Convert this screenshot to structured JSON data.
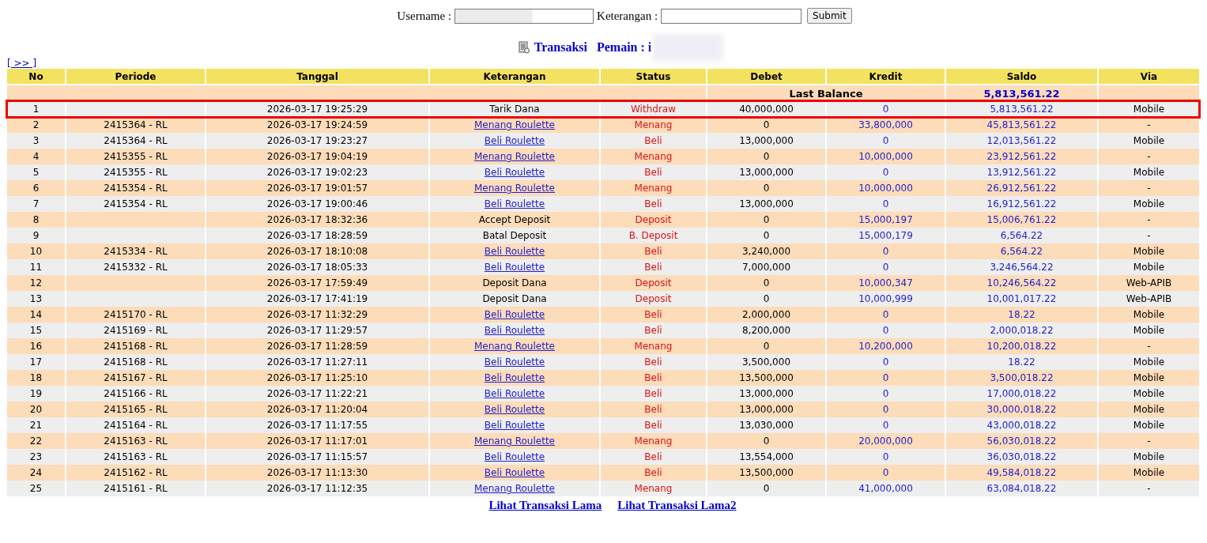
{
  "form": {
    "username_label": "Username :",
    "keterangan_label": "Keterangan :",
    "submit": "Submit"
  },
  "heading": {
    "title": "Transaksi",
    "player": "Pemain : i"
  },
  "next_link": "[ >> ]",
  "table": {
    "columns": [
      "No",
      "Periode",
      "Tanggal",
      "Keterangan",
      "Status",
      "Debet",
      "Kredit",
      "Saldo",
      "Via"
    ],
    "last_balance": {
      "label": "Last Balance",
      "value": "5,813,561.22"
    },
    "rows": [
      {
        "no": "1",
        "periode": "",
        "tanggal": "2026-03-17 19:25:29",
        "keterangan": "Tarik Dana",
        "link": false,
        "status": "Withdraw",
        "debet": "40,000,000",
        "kredit": "0",
        "saldo": "5,813,561.22",
        "via": "Mobile",
        "highlighted": true
      },
      {
        "no": "2",
        "periode": "2415364 - RL",
        "tanggal": "2026-03-17 19:24:59",
        "keterangan": "Menang Roulette",
        "link": true,
        "status": "Menang",
        "debet": "0",
        "kredit": "33,800,000",
        "saldo": "45,813,561.22",
        "via": "-",
        "highlighted": false
      },
      {
        "no": "3",
        "periode": "2415364 - RL",
        "tanggal": "2026-03-17 19:23:27",
        "keterangan": "Beli Roulette",
        "link": true,
        "status": "Beli",
        "debet": "13,000,000",
        "kredit": "0",
        "saldo": "12,013,561.22",
        "via": "Mobile",
        "highlighted": false
      },
      {
        "no": "4",
        "periode": "2415355 - RL",
        "tanggal": "2026-03-17 19:04:19",
        "keterangan": "Menang Roulette",
        "link": true,
        "status": "Menang",
        "debet": "0",
        "kredit": "10,000,000",
        "saldo": "23,912,561.22",
        "via": "-",
        "highlighted": false
      },
      {
        "no": "5",
        "periode": "2415355 - RL",
        "tanggal": "2026-03-17 19:02:23",
        "keterangan": "Beli Roulette",
        "link": true,
        "status": "Beli",
        "debet": "13,000,000",
        "kredit": "0",
        "saldo": "13,912,561.22",
        "via": "Mobile",
        "highlighted": false
      },
      {
        "no": "6",
        "periode": "2415354 - RL",
        "tanggal": "2026-03-17 19:01:57",
        "keterangan": "Menang Roulette",
        "link": true,
        "status": "Menang",
        "debet": "0",
        "kredit": "10,000,000",
        "saldo": "26,912,561.22",
        "via": "-",
        "highlighted": false
      },
      {
        "no": "7",
        "periode": "2415354 - RL",
        "tanggal": "2026-03-17 19:00:46",
        "keterangan": "Beli Roulette",
        "link": true,
        "status": "Beli",
        "debet": "13,000,000",
        "kredit": "0",
        "saldo": "16,912,561.22",
        "via": "Mobile",
        "highlighted": false
      },
      {
        "no": "8",
        "periode": "",
        "tanggal": "2026-03-17 18:32:36",
        "keterangan": "Accept Deposit",
        "link": false,
        "status": "Deposit",
        "debet": "0",
        "kredit": "15,000,197",
        "saldo": "15,006,761.22",
        "via": "-",
        "highlighted": false
      },
      {
        "no": "9",
        "periode": "",
        "tanggal": "2026-03-17 18:28:59",
        "keterangan": "Batal Deposit",
        "link": false,
        "status": "B. Deposit",
        "debet": "0",
        "kredit": "15,000,179",
        "saldo": "6,564.22",
        "via": "-",
        "highlighted": false
      },
      {
        "no": "10",
        "periode": "2415334 - RL",
        "tanggal": "2026-03-17 18:10:08",
        "keterangan": "Beli Roulette",
        "link": true,
        "status": "Beli",
        "debet": "3,240,000",
        "kredit": "0",
        "saldo": "6,564.22",
        "via": "Mobile",
        "highlighted": false
      },
      {
        "no": "11",
        "periode": "2415332 - RL",
        "tanggal": "2026-03-17 18:05:33",
        "keterangan": "Beli Roulette",
        "link": true,
        "status": "Beli",
        "debet": "7,000,000",
        "kredit": "0",
        "saldo": "3,246,564.22",
        "via": "Mobile",
        "highlighted": false
      },
      {
        "no": "12",
        "periode": "",
        "tanggal": "2026-03-17 17:59:49",
        "keterangan": "Deposit Dana",
        "link": false,
        "status": "Deposit",
        "debet": "0",
        "kredit": "10,000,347",
        "saldo": "10,246,564.22",
        "via": "Web-APIB",
        "highlighted": false
      },
      {
        "no": "13",
        "periode": "",
        "tanggal": "2026-03-17 17:41:19",
        "keterangan": "Deposit Dana",
        "link": false,
        "status": "Deposit",
        "debet": "0",
        "kredit": "10,000,999",
        "saldo": "10,001,017.22",
        "via": "Web-APIB",
        "highlighted": false
      },
      {
        "no": "14",
        "periode": "2415170 - RL",
        "tanggal": "2026-03-17 11:32:29",
        "keterangan": "Beli Roulette",
        "link": true,
        "status": "Beli",
        "debet": "2,000,000",
        "kredit": "0",
        "saldo": "18.22",
        "via": "Mobile",
        "highlighted": false
      },
      {
        "no": "15",
        "periode": "2415169 - RL",
        "tanggal": "2026-03-17 11:29:57",
        "keterangan": "Beli Roulette",
        "link": true,
        "status": "Beli",
        "debet": "8,200,000",
        "kredit": "0",
        "saldo": "2,000,018.22",
        "via": "Mobile",
        "highlighted": false
      },
      {
        "no": "16",
        "periode": "2415168 - RL",
        "tanggal": "2026-03-17 11:28:59",
        "keterangan": "Menang Roulette",
        "link": true,
        "status": "Menang",
        "debet": "0",
        "kredit": "10,200,000",
        "saldo": "10,200,018.22",
        "via": "-",
        "highlighted": false
      },
      {
        "no": "17",
        "periode": "2415168 - RL",
        "tanggal": "2026-03-17 11:27:11",
        "keterangan": "Beli Roulette",
        "link": true,
        "status": "Beli",
        "debet": "3,500,000",
        "kredit": "0",
        "saldo": "18.22",
        "via": "Mobile",
        "highlighted": false
      },
      {
        "no": "18",
        "periode": "2415167 - RL",
        "tanggal": "2026-03-17 11:25:10",
        "keterangan": "Beli Roulette",
        "link": true,
        "status": "Beli",
        "debet": "13,500,000",
        "kredit": "0",
        "saldo": "3,500,018.22",
        "via": "Mobile",
        "highlighted": false
      },
      {
        "no": "19",
        "periode": "2415166 - RL",
        "tanggal": "2026-03-17 11:22:21",
        "keterangan": "Beli Roulette",
        "link": true,
        "status": "Beli",
        "debet": "13,000,000",
        "kredit": "0",
        "saldo": "17,000,018.22",
        "via": "Mobile",
        "highlighted": false
      },
      {
        "no": "20",
        "periode": "2415165 - RL",
        "tanggal": "2026-03-17 11:20:04",
        "keterangan": "Beli Roulette",
        "link": true,
        "status": "Beli",
        "debet": "13,000,000",
        "kredit": "0",
        "saldo": "30,000,018.22",
        "via": "Mobile",
        "highlighted": false
      },
      {
        "no": "21",
        "periode": "2415164 - RL",
        "tanggal": "2026-03-17 11:17:55",
        "keterangan": "Beli Roulette",
        "link": true,
        "status": "Beli",
        "debet": "13,030,000",
        "kredit": "0",
        "saldo": "43,000,018.22",
        "via": "Mobile",
        "highlighted": false
      },
      {
        "no": "22",
        "periode": "2415163 - RL",
        "tanggal": "2026-03-17 11:17:01",
        "keterangan": "Menang Roulette",
        "link": true,
        "status": "Menang",
        "debet": "0",
        "kredit": "20,000,000",
        "saldo": "56,030,018.22",
        "via": "-",
        "highlighted": false
      },
      {
        "no": "23",
        "periode": "2415163 - RL",
        "tanggal": "2026-03-17 11:15:57",
        "keterangan": "Beli Roulette",
        "link": true,
        "status": "Beli",
        "debet": "13,554,000",
        "kredit": "0",
        "saldo": "36,030,018.22",
        "via": "Mobile",
        "highlighted": false
      },
      {
        "no": "24",
        "periode": "2415162 - RL",
        "tanggal": "2026-03-17 11:13:30",
        "keterangan": "Beli Roulette",
        "link": true,
        "status": "Beli",
        "debet": "13,500,000",
        "kredit": "0",
        "saldo": "49,584,018.22",
        "via": "Mobile",
        "highlighted": false
      },
      {
        "no": "25",
        "periode": "2415161 - RL",
        "tanggal": "2026-03-17 11:12:35",
        "keterangan": "Menang Roulette",
        "link": true,
        "status": "Menang",
        "debet": "0",
        "kredit": "41,000,000",
        "saldo": "63,084,018.22",
        "via": "-",
        "highlighted": false
      }
    ]
  },
  "footer_links": [
    "Lihat Transaksi Lama",
    "Lihat Transaksi Lama2"
  ]
}
